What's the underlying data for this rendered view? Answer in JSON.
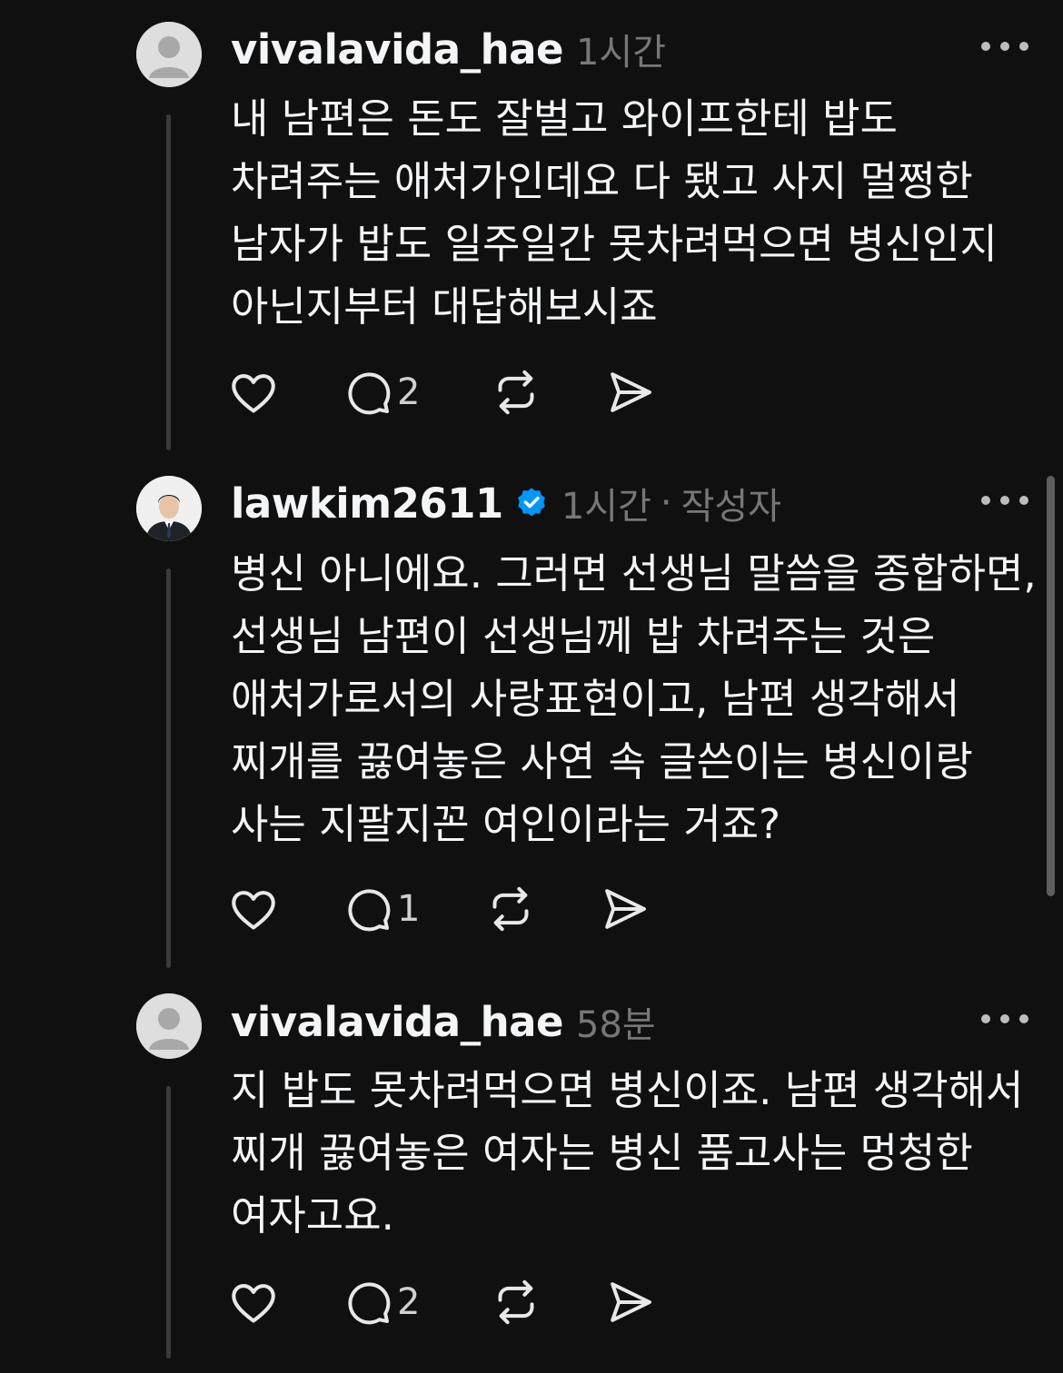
{
  "comments": [
    {
      "username": "vivalavida_hae",
      "time": "1시간",
      "verified": false,
      "author_badge": "",
      "text": "내 남편은 돈도 잘벌고 와이프한테 밥도 차려주는 애처가인데요 다 됐고 사지 멀쩡한 남자가 밥도 일주일간 못차려먹으면 병신인지 아닌지부터 대답해보시죠",
      "reply_count": "2",
      "avatar": "default-avatar-icon"
    },
    {
      "username": "lawkim2611",
      "time": "1시간",
      "verified": true,
      "author_badge": "작성자",
      "text": "병신 아니에요. 그러면 선생님 말씀을 종합하면, 선생님 남편이 선생님께 밥 차려주는 것은 애처가로서의 사랑표현이고, 남편 생각해서 찌개를 끓여놓은 사연 속 글쓴이는 병신이랑 사는 지팔지꼰 여인이라는 거죠?",
      "reply_count": "1",
      "avatar": "profile-photo"
    },
    {
      "username": "vivalavida_hae",
      "time": "58분",
      "verified": false,
      "author_badge": "",
      "text": "지 밥도 못차려먹으면 병신이죠. 남편 생각해서 찌개 끓여놓은 여자는 병신 품고사는 멍청한 여자고요.",
      "reply_count": "2",
      "avatar": "default-avatar-icon"
    }
  ],
  "separator": "·",
  "icons": {
    "like": "heart-icon",
    "reply": "speech-bubble-icon",
    "repost": "repost-icon",
    "share": "send-icon",
    "more": "more-dots-icon",
    "verified": "verified-badge-icon"
  },
  "colors": {
    "background": "#101010",
    "text": "#f3f5f7",
    "muted": "#777777",
    "verified": "#0095f6",
    "thread_line": "#3a3a3a"
  }
}
